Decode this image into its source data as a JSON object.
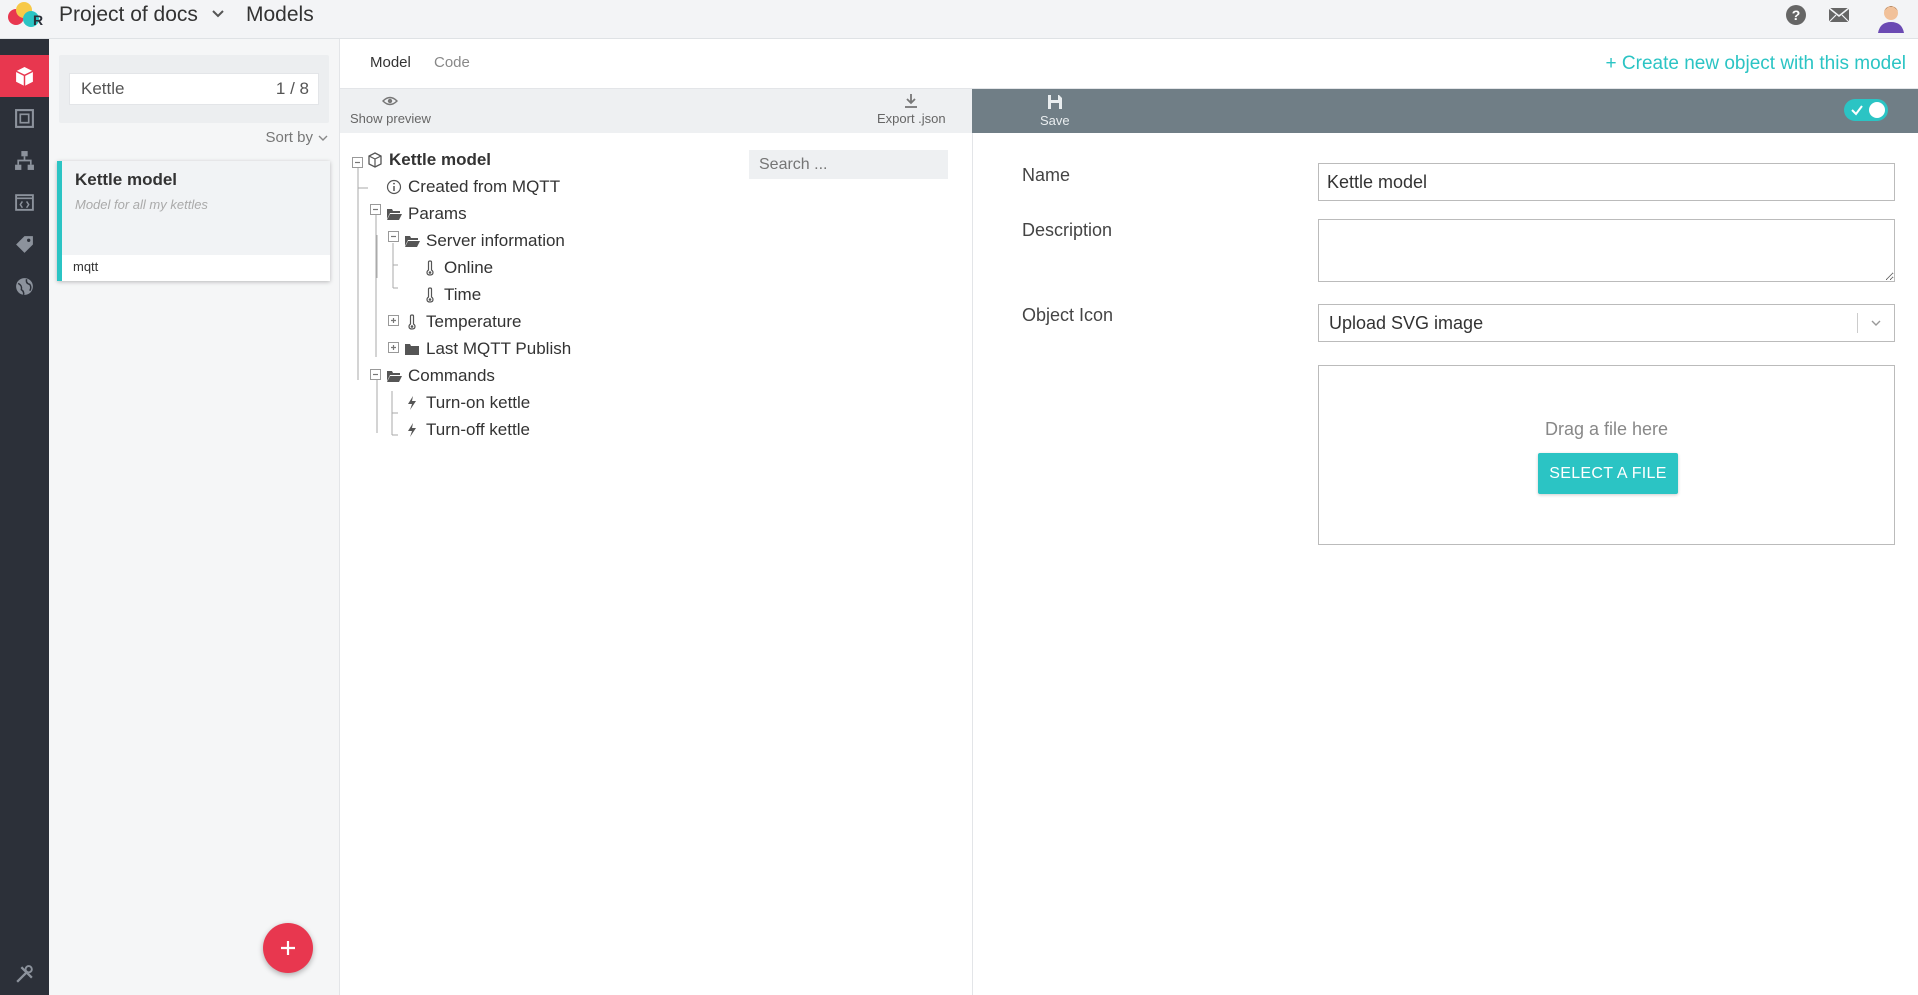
{
  "header": {
    "project_name": "Project of docs",
    "section_title": "Models"
  },
  "colors": {
    "accent": "#2bc4c4",
    "danger": "#e8374f",
    "nav_bg": "#2c3039",
    "toolbar_bg": "#707e86"
  },
  "nav": {
    "items": [
      {
        "name": "models",
        "icon": "cube-icon",
        "active": true
      },
      {
        "name": "objects",
        "icon": "square-frame-icon",
        "active": false
      },
      {
        "name": "hierarchy",
        "icon": "sitemap-icon",
        "active": false
      },
      {
        "name": "apps",
        "icon": "code-window-icon",
        "active": false
      },
      {
        "name": "tags",
        "icon": "tag-icon",
        "active": false
      },
      {
        "name": "integrations",
        "icon": "globe-icon",
        "active": false
      }
    ],
    "bottom_icon": "tools-icon"
  },
  "list": {
    "search_value": "Kettle",
    "count": "1 / 8",
    "sort_label": "Sort by",
    "cards": [
      {
        "title": "Kettle model",
        "description": "Model for all my kettles",
        "tag": "mqtt"
      }
    ]
  },
  "tabs": {
    "model": "Model",
    "code": "Code",
    "create_link": "+ Create new object with this model"
  },
  "tree_toolbar": {
    "preview_label": "Show preview",
    "export_label": "Export .json"
  },
  "form_toolbar": {
    "save_label": "Save",
    "toggle_on": true
  },
  "tree": {
    "search_placeholder": "Search ...",
    "nodes": [
      {
        "label": "Kettle model",
        "icon": "cube-icon"
      },
      {
        "label": "Created from MQTT",
        "icon": "info-icon"
      },
      {
        "label": "Params",
        "icon": "folder-open-icon"
      },
      {
        "label": "Server information",
        "icon": "folder-open-icon"
      },
      {
        "label": "Online",
        "icon": "thermometer-icon"
      },
      {
        "label": "Time",
        "icon": "thermometer-icon"
      },
      {
        "label": "Temperature",
        "icon": "thermometer-icon"
      },
      {
        "label": "Last MQTT Publish",
        "icon": "folder-icon"
      },
      {
        "label": "Commands",
        "icon": "folder-open-icon"
      },
      {
        "label": "Turn-on kettle",
        "icon": "bolt-icon"
      },
      {
        "label": "Turn-off kettle",
        "icon": "bolt-icon"
      }
    ]
  },
  "form": {
    "name_label": "Name",
    "name_value": "Kettle model",
    "description_label": "Description",
    "description_value": "",
    "icon_label": "Object Icon",
    "icon_select_value": "Upload SVG image",
    "drop_text": "Drag a file here",
    "select_file_label": "SELECT A FILE"
  }
}
